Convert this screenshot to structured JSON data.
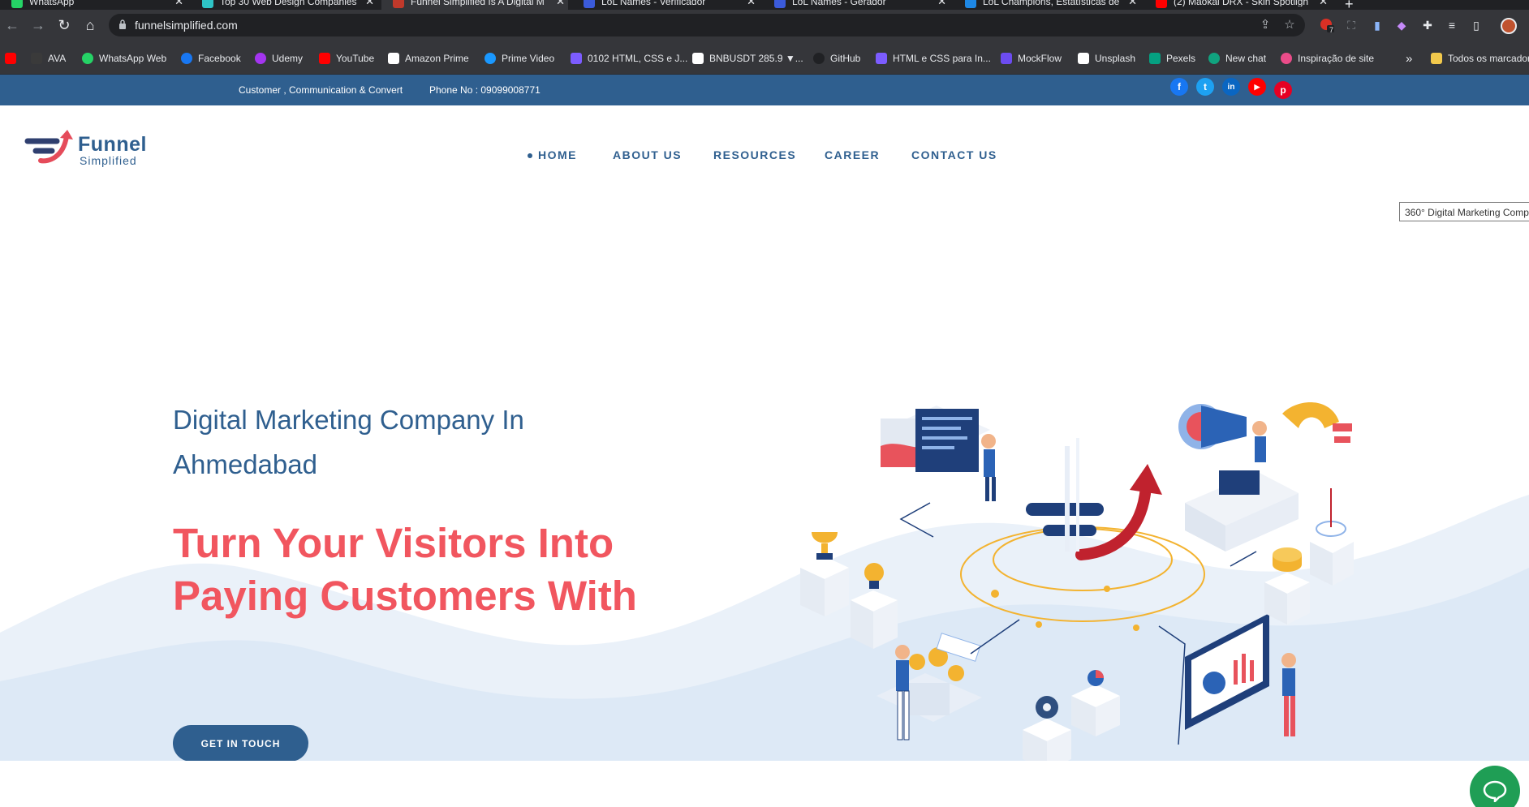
{
  "browser": {
    "tabs": [
      {
        "title": "WhatsApp",
        "color": "#25d366"
      },
      {
        "title": "Top 30 Web Design Companies",
        "color": "#2ec4c6"
      },
      {
        "title": "Funnel Simplified Is A Digital M",
        "color": "#c0392b"
      },
      {
        "title": "LoL Names - Verificador",
        "color": "#3b5bdb"
      },
      {
        "title": "LoL Names - Gerador",
        "color": "#3b5bdb"
      },
      {
        "title": "LoL Champions, Estatísticas de",
        "color": "#1e88e5"
      },
      {
        "title": "(2) Maokai DRX - Skin Spotligh",
        "color": "#ff0000"
      }
    ],
    "new_tab_label": "+",
    "url": "funnelsimplified.com",
    "extension_badge": "7",
    "bookmarks": [
      {
        "label": "",
        "color": "#ff0000"
      },
      {
        "label": "AVA",
        "color": "#3a3a3a"
      },
      {
        "label": "WhatsApp Web",
        "color": "#25d366"
      },
      {
        "label": "Facebook",
        "color": "#1877f2"
      },
      {
        "label": "Udemy",
        "color": "#a435f0"
      },
      {
        "label": "YouTube",
        "color": "#ff0000"
      },
      {
        "label": "Amazon Prime",
        "color": "#ffffff"
      },
      {
        "label": "Prime Video",
        "color": "#1a98ff"
      },
      {
        "label": "0102 HTML, CSS e J...",
        "color": "#7c5cff"
      },
      {
        "label": "BNBUSDT 285.9 ▼...",
        "color": "#ffffff"
      },
      {
        "label": "GitHub",
        "color": "#202124"
      },
      {
        "label": "HTML e CSS para In...",
        "color": "#7c5cff"
      },
      {
        "label": "MockFlow",
        "color": "#6c4cf0"
      },
      {
        "label": "Unsplash",
        "color": "#ffffff"
      },
      {
        "label": "Pexels",
        "color": "#05a081"
      },
      {
        "label": "New chat",
        "color": "#10a37f"
      },
      {
        "label": "Inspiração de site",
        "color": "#ea4c89"
      }
    ],
    "bookmarks_overflow": "»",
    "all_bookmarks": "Todos os marcadores"
  },
  "site": {
    "topbar": {
      "tagline": "Customer , Communication & Convert",
      "phone": "Phone No : 09099008771",
      "social": [
        {
          "name": "facebook",
          "glyph": "f",
          "color": "#1877f2"
        },
        {
          "name": "twitter",
          "glyph": "t",
          "color": "#1da1f2"
        },
        {
          "name": "linkedin",
          "glyph": "in",
          "color": "#0a66c2"
        },
        {
          "name": "youtube",
          "glyph": "▶",
          "color": "#ff0000"
        },
        {
          "name": "pinterest",
          "glyph": "p",
          "color": "#e60023"
        }
      ]
    },
    "logo": {
      "word": "Funnel",
      "sub": "Simplified"
    },
    "menu": [
      "HOME",
      "ABOUT US",
      "RESOURCES",
      "CAREER",
      "CONTACT US"
    ],
    "hero": {
      "subtitle": "Digital Marketing Company In Ahmedabad",
      "title": "Turn Your Visitors Into Paying Customers With",
      "cta": "GET IN TOUCH",
      "image_tooltip": "360° Digital Marketing Comp"
    },
    "colors": {
      "primary": "#2f5f8f",
      "accent": "#f1565f",
      "chat": "#1f9e55"
    }
  }
}
